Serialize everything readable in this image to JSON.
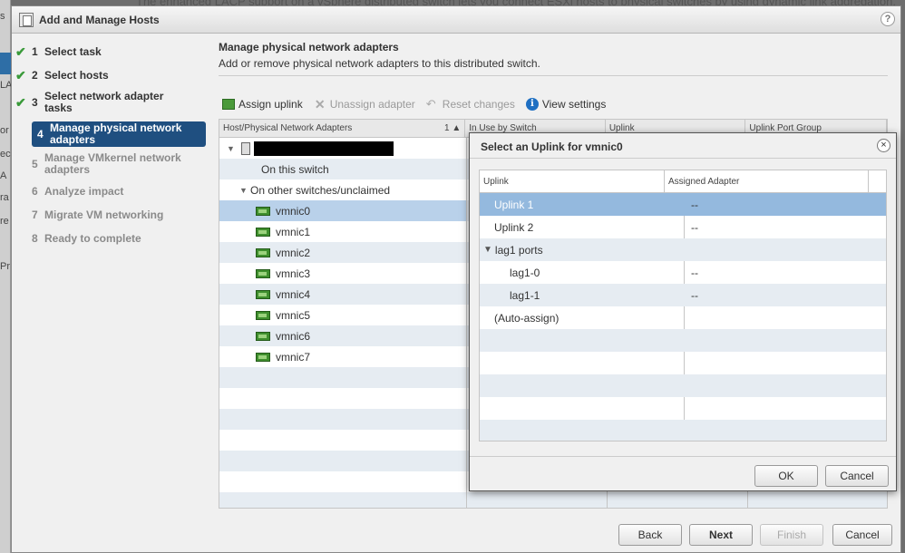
{
  "background": {
    "banner": "The enhanced LACP support on a vSphere distributed switch lets you connect ESXi hosts to physical switches by using dynamic link aggregation.",
    "strip_fragments": [
      "s",
      "LA",
      "or",
      "ec",
      "A",
      "ra",
      "re",
      "Pr"
    ]
  },
  "window": {
    "title": "Add and Manage Hosts",
    "help": "?"
  },
  "steps": [
    {
      "num": "1",
      "label": "Select task",
      "state": "done"
    },
    {
      "num": "2",
      "label": "Select hosts",
      "state": "done"
    },
    {
      "num": "3",
      "label": "Select network adapter tasks",
      "state": "done"
    },
    {
      "num": "4",
      "label": "Manage physical network adapters",
      "state": "active"
    },
    {
      "num": "5",
      "label": "Manage VMkernel network adapters",
      "state": "pending"
    },
    {
      "num": "6",
      "label": "Analyze impact",
      "state": "pending"
    },
    {
      "num": "7",
      "label": "Migrate VM networking",
      "state": "pending"
    },
    {
      "num": "8",
      "label": "Ready to complete",
      "state": "pending"
    }
  ],
  "main": {
    "title": "Manage physical network adapters",
    "subtitle": "Add or remove physical network adapters to this distributed switch.",
    "toolbar": {
      "assign": "Assign uplink",
      "unassign": "Unassign adapter",
      "reset": "Reset changes",
      "view": "View settings"
    },
    "grid": {
      "headers": [
        "Host/Physical Network Adapters",
        "In Use by Switch",
        "Uplink",
        "Uplink Port Group"
      ],
      "sort": "1 ▲",
      "on_this_switch": "On this switch",
      "on_other": "On other switches/unclaimed",
      "adapters": [
        "vmnic0",
        "vmnic1",
        "vmnic2",
        "vmnic3",
        "vmnic4",
        "vmnic5",
        "vmnic6",
        "vmnic7"
      ]
    }
  },
  "footer": {
    "back": "Back",
    "next": "Next",
    "finish": "Finish",
    "cancel": "Cancel"
  },
  "dialog": {
    "title": "Select an Uplink for vmnic0",
    "close": "×",
    "headers": [
      "Uplink",
      "Assigned Adapter"
    ],
    "rows": [
      {
        "uplink": "Uplink 1",
        "adapter": "--"
      },
      {
        "uplink": "Uplink 2",
        "adapter": "--"
      },
      {
        "uplink": "lag1 ports",
        "adapter": ""
      },
      {
        "uplink": "lag1-0",
        "adapter": "--"
      },
      {
        "uplink": "lag1-1",
        "adapter": "--"
      },
      {
        "uplink": "(Auto-assign)",
        "adapter": ""
      }
    ],
    "ok": "OK",
    "cancel": "Cancel"
  }
}
